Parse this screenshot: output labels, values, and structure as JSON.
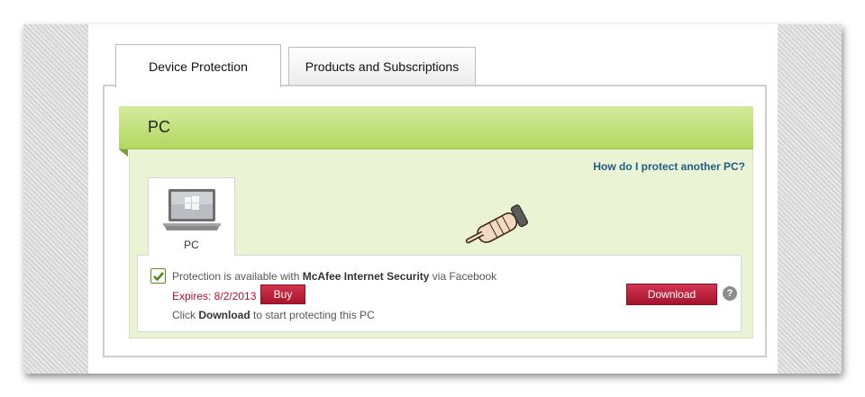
{
  "tabs": [
    {
      "label": "Device Protection",
      "active": true
    },
    {
      "label": "Products and Subscriptions",
      "active": false
    }
  ],
  "section": {
    "title": "PC",
    "help_link": "How do I protect another PC?"
  },
  "device": {
    "label": "PC",
    "icon": "laptop-icon"
  },
  "protection": {
    "text_prefix": "Protection is available with ",
    "product_name": "McAfee Internet Security",
    "text_suffix": " via Facebook",
    "expires": "Expires: 8/2/2013",
    "buy_label": "Buy",
    "instruction_prefix": "Click ",
    "instruction_bold": "Download",
    "instruction_suffix": " to start protecting this PC",
    "download_label": "Download",
    "help_icon": "?"
  },
  "colors": {
    "accent_green": "#b2d860",
    "button_red": "#a8162c",
    "link_blue": "#1f5c88",
    "expires_red": "#b0102c"
  }
}
